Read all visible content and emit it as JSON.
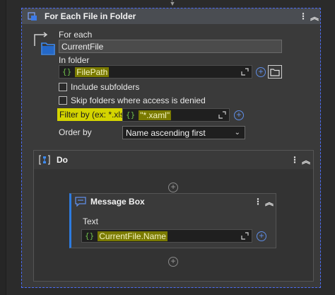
{
  "activity": {
    "title": "For Each File in Folder",
    "for_each_label": "For each",
    "for_each_value": "CurrentFile",
    "in_folder_label": "In folder",
    "in_folder_value": "FilePath",
    "include_subfolders_label": "Include subfolders",
    "skip_folders_label": "Skip folders where access is denied",
    "filter_label": "Filter by (ex: *.xlsx)",
    "filter_value": "\"*.xaml\"",
    "order_by_label": "Order by",
    "order_by_value": "Name ascending first"
  },
  "do_sequence": {
    "title": "Do",
    "message_box": {
      "title": "Message Box",
      "text_label": "Text",
      "text_value": "CurrentFile.Name"
    }
  },
  "glyphs": {
    "brace": "{}",
    "plus": "+",
    "kebab": "⋮",
    "collapse": "︽",
    "caret": "⌄"
  },
  "colors": {
    "highlight": "#d4d400",
    "accent": "#4a6cf7",
    "expression_brace": "#6fbf4a",
    "message_accent": "#2d7be0"
  }
}
